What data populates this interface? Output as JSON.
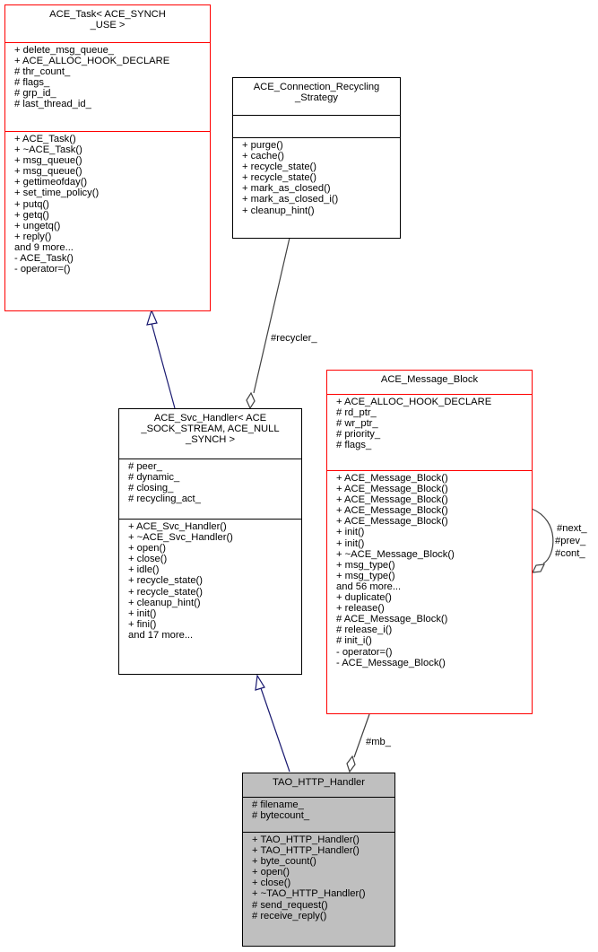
{
  "classes": {
    "ace_task": {
      "title_lines": [
        "ACE_Task< ACE_SYNCH",
        "_USE >"
      ],
      "attributes": [
        "+ delete_msg_queue_",
        "+ ACE_ALLOC_HOOK_DECLARE",
        "# thr_count_",
        "# flags_",
        "# grp_id_",
        "# last_thread_id_"
      ],
      "methods": [
        "+ ACE_Task()",
        "+ ~ACE_Task()",
        "+ msg_queue()",
        "+ msg_queue()",
        "+ gettimeofday()",
        "+ set_time_policy()",
        "+ putq()",
        "+ getq()",
        "+ ungetq()",
        "+ reply()",
        "and 9 more...",
        "- ACE_Task()",
        "- operator=()"
      ]
    },
    "ace_connection_recycling_strategy": {
      "title_lines": [
        "ACE_Connection_Recycling",
        "_Strategy"
      ],
      "attributes": [],
      "methods": [
        "+ purge()",
        "+ cache()",
        "+ recycle_state()",
        "+ recycle_state()",
        "+ mark_as_closed()",
        "+ mark_as_closed_i()",
        "+ cleanup_hint()"
      ]
    },
    "ace_svc_handler": {
      "title_lines": [
        "ACE_Svc_Handler< ACE",
        "_SOCK_STREAM, ACE_NULL",
        "_SYNCH >"
      ],
      "attributes": [
        "# peer_",
        "# dynamic_",
        "# closing_",
        "# recycling_act_"
      ],
      "methods": [
        "+ ACE_Svc_Handler()",
        "+ ~ACE_Svc_Handler()",
        "+ open()",
        "+ close()",
        "+ idle()",
        "+ recycle_state()",
        "+ recycle_state()",
        "+ cleanup_hint()",
        "+ init()",
        "+ fini()",
        "and 17 more..."
      ]
    },
    "ace_message_block": {
      "title_lines": [
        "ACE_Message_Block"
      ],
      "attributes": [
        "+ ACE_ALLOC_HOOK_DECLARE",
        "# rd_ptr_",
        "# wr_ptr_",
        "# priority_",
        "# flags_"
      ],
      "methods": [
        "+ ACE_Message_Block()",
        "+ ACE_Message_Block()",
        "+ ACE_Message_Block()",
        "+ ACE_Message_Block()",
        "+ ACE_Message_Block()",
        "+ init()",
        "+ init()",
        "+ ~ACE_Message_Block()",
        "+ msg_type()",
        "+ msg_type()",
        "and 56 more...",
        "+ duplicate()",
        "+ release()",
        "# ACE_Message_Block()",
        "# release_i()",
        "# init_i()",
        "- operator=()",
        "- ACE_Message_Block()"
      ]
    },
    "tao_http_handler": {
      "title_lines": [
        "TAO_HTTP_Handler"
      ],
      "attributes": [
        "# filename_",
        "# bytecount_"
      ],
      "methods": [
        "+ TAO_HTTP_Handler()",
        "+ TAO_HTTP_Handler()",
        "+ byte_count()",
        "+ open()",
        "+ close()",
        "+ ~TAO_HTTP_Handler()",
        "# send_request()",
        "# receive_reply()"
      ]
    }
  },
  "edge_labels": {
    "recycler": "#recycler_",
    "mb": "#mb_",
    "self_next": "#next_",
    "self_prev": "#prev_",
    "self_cont": "#cont_"
  },
  "colors": {
    "inheritance": "#191970",
    "association": "#404040",
    "highlight_border": "#ff0000",
    "focus_fill": "#bfbfbf"
  }
}
